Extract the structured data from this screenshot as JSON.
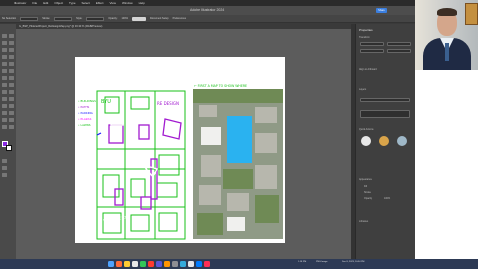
{
  "menubar": {
    "items": [
      "Illustrator",
      "File",
      "Edit",
      "Object",
      "Type",
      "Select",
      "Effect",
      "View",
      "Window",
      "Help"
    ]
  },
  "app": {
    "title": "Adobe Illustrator 2024",
    "share_label": "Share"
  },
  "control_bar": {
    "items": [
      "No Selection",
      "Stroke:",
      "Style:",
      "Opacity:",
      "100%",
      "Document Setup",
      "Preferences"
    ]
  },
  "document_tab": {
    "label": "IL_BSP_PilderedProject_ReDesignMap.png* @ 33.33 % (RGB/Preview)"
  },
  "sketch_notes": {
    "header_left": "BYU",
    "header_right": "RE DESIGN",
    "legend": [
      "• BUILDINGS",
      "• PATHS",
      "• PARKING",
      "• PLAZAS",
      "• LAWNS"
    ],
    "map_caption": "← FIRST  A MAP TO SHOW WHERE",
    "label_fields": "UPPER FIELDS"
  },
  "properties_panel": {
    "title": "Properties",
    "section_transform": "Transform",
    "align_label": "Align to Artboard",
    "section_layers": "Layers",
    "section_appearance": "Appearance",
    "fill_label": "Fill",
    "stroke_label": "Stroke",
    "opacity_label": "Opacity",
    "opacity_value": "100%",
    "section_quick": "Quick Actions",
    "section_libraries": "Libraries"
  },
  "dock_status": {
    "items": [
      "1:18 PM",
      "PNG Image",
      "Dec 8, 2023, 10:54 PM"
    ]
  },
  "colors": {
    "sketch_green": "#19c219",
    "sketch_purple": "#a21bd0",
    "highlight_blue": "#2ab2f0",
    "share_blue": "#3b7fe0"
  }
}
